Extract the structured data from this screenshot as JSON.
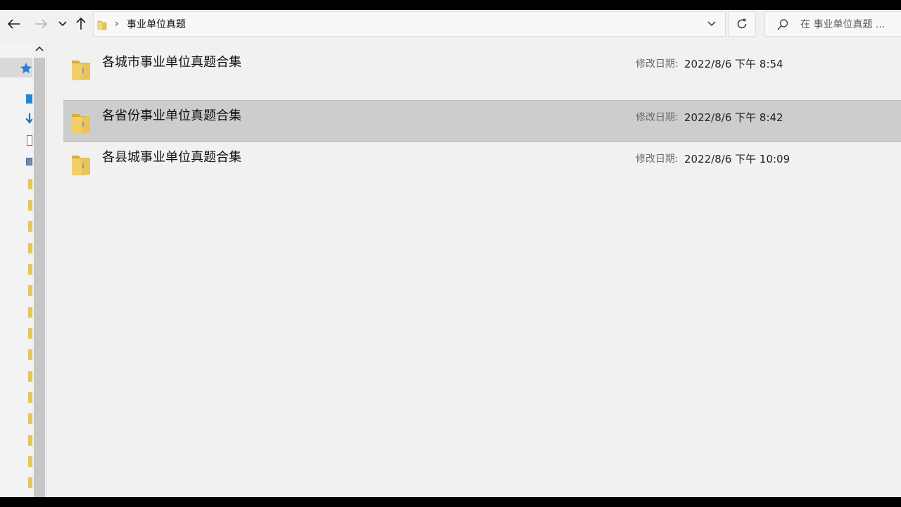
{
  "address": {
    "path": "事业单位真题",
    "separator": "›"
  },
  "search": {
    "placeholder": "在 事业单位真题 ..."
  },
  "colors": {
    "folder": "#e8c55a",
    "folder_dark": "#d9ad3a",
    "selection": "#cdcdcd",
    "quick_access_star": "#2b7fd9"
  },
  "items": [
    {
      "name": "各城市事业单位真题合集",
      "date_label": "修改日期:",
      "date_value": "2022/8/6 下午 8:54",
      "selected": false
    },
    {
      "name": "各省份事业单位真题合集",
      "date_label": "修改日期:",
      "date_value": "2022/8/6 下午 8:42",
      "selected": true
    },
    {
      "name": "各县城事业单位真题合集",
      "date_label": "修改日期:",
      "date_value": "2022/8/6 下午 10:09",
      "selected": false
    }
  ]
}
